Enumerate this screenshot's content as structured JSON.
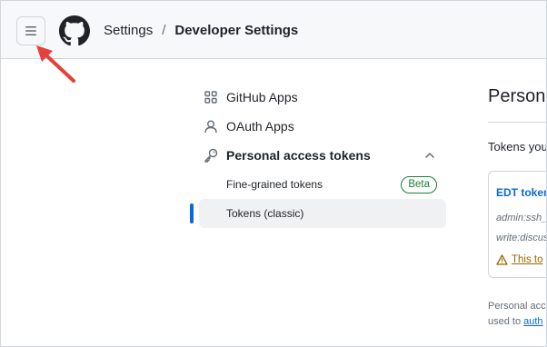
{
  "colors": {
    "header_bg": "#f6f8fa",
    "link": "#0969da",
    "active_indicator": "#0969da",
    "beta_badge": "#1a7f37",
    "warning": "#9a6700",
    "arrow": "#e5403a"
  },
  "header": {
    "menu_icon": "hamburger-icon",
    "logo_icon": "github-octocat-icon",
    "breadcrumb": {
      "root": "Settings",
      "separator": "/",
      "current": "Developer Settings"
    }
  },
  "sidebar": {
    "items": [
      {
        "label": "GitHub Apps",
        "icon": "apps-grid-icon"
      },
      {
        "label": "OAuth Apps",
        "icon": "person-icon"
      }
    ],
    "group": {
      "label": "Personal access tokens",
      "icon": "key-icon",
      "expanded_icon": "chevron-up-icon",
      "children": [
        {
          "label": "Fine-grained tokens",
          "badge": "Beta"
        },
        {
          "label": "Tokens (classic)",
          "active": true
        }
      ]
    }
  },
  "main": {
    "title": "Persona",
    "intro": "Tokens you",
    "token": {
      "name": "EDT token",
      "scopes": [
        "admin:ssh_",
        "write:discus"
      ],
      "warning": "This to",
      "warning_icon": "alert-triangle-icon"
    },
    "footer": {
      "line1": "Personal acc",
      "line2_prefix": "used to ",
      "line2_link": "auth"
    }
  }
}
